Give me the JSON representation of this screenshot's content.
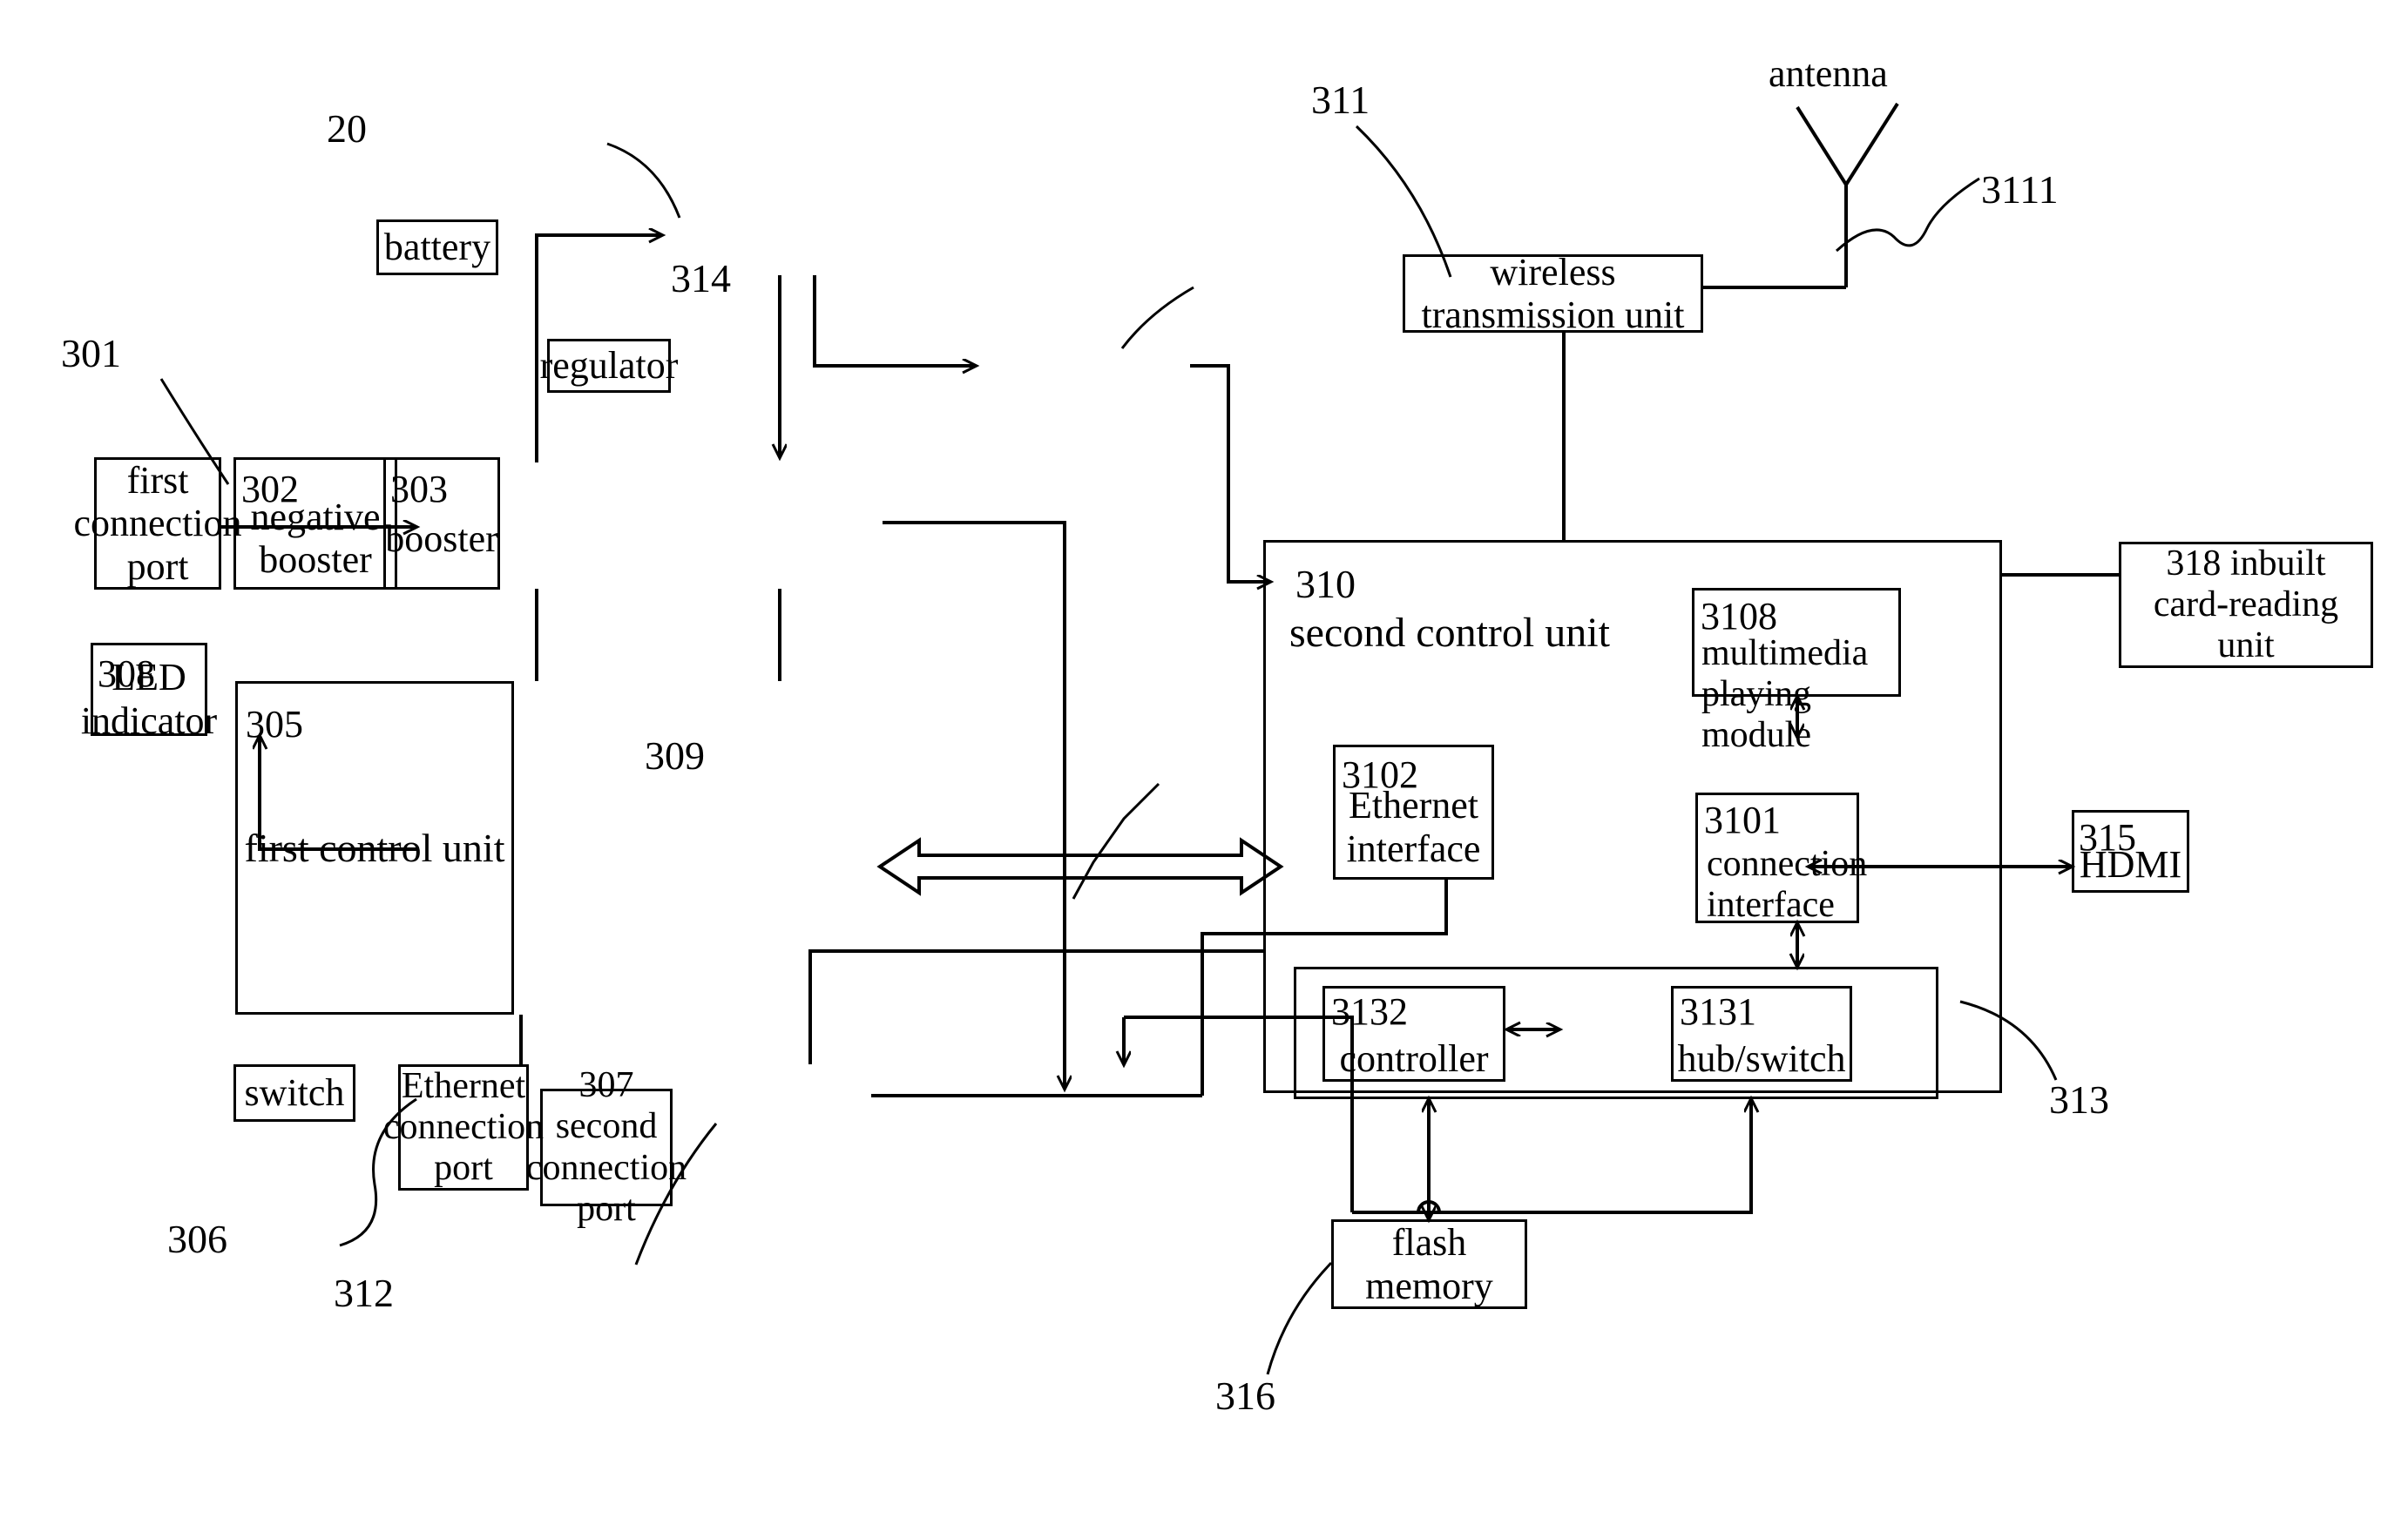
{
  "figure": {
    "type": "patent-block-diagram",
    "stroke_color": "#000000",
    "background_color": "#ffffff"
  },
  "blocks": {
    "first_connection_port": {
      "ref": "301",
      "label": "first\nconnection\nport"
    },
    "negative_booster": {
      "ref": "302",
      "label": "negative\nbooster"
    },
    "booster": {
      "ref": "303",
      "label": "booster"
    },
    "first_control_unit": {
      "ref": "305",
      "label": "first control unit"
    },
    "switch": {
      "ref": "306",
      "label": "switch"
    },
    "second_connection_port": {
      "ref": "307",
      "label": "307 second\nconnection\nport"
    },
    "led_indicator": {
      "ref": "308",
      "label": "LED\nindicator"
    },
    "bidirectional_bus": {
      "ref": "309",
      "label": ""
    },
    "second_control_unit": {
      "ref": "310",
      "label": "second control unit"
    },
    "wireless_transmission_unit": {
      "ref": "311",
      "label": "wireless\ntransmission unit"
    },
    "antenna": {
      "ref": "3111",
      "label": "antenna"
    },
    "ethernet_connection_port": {
      "ref": "312",
      "label": "Ethernet\nconnection\nport"
    },
    "hub_switch_group": {
      "ref": "313",
      "label": ""
    },
    "regulator": {
      "ref": "314",
      "label": "regulator"
    },
    "hdmi": {
      "ref": "315",
      "label": "HDMI"
    },
    "flash_memory": {
      "ref": "316",
      "label": "flash\nmemory"
    },
    "inbuilt_card_reading_unit": {
      "ref": "318",
      "label": "318   inbuilt\ncard-reading\nunit"
    },
    "battery": {
      "ref": "20",
      "label": "battery"
    },
    "connection_interface": {
      "ref": "3101",
      "label": "connection\ninterface"
    },
    "ethernet_interface": {
      "ref": "3102",
      "label": "Ethernet\ninterface"
    },
    "multimedia_playing_module": {
      "ref": "3108",
      "label": "multimedia\nplaying module"
    },
    "hub_switch": {
      "ref": "3131",
      "label": "hub/switch"
    },
    "controller": {
      "ref": "3132",
      "label": "controller"
    }
  }
}
